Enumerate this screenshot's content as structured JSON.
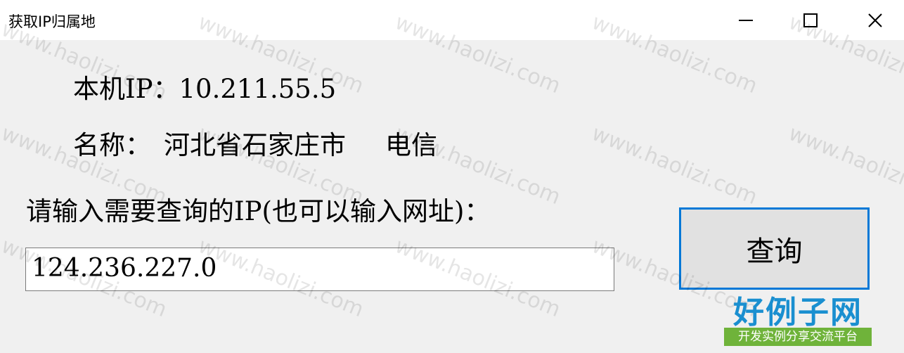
{
  "window": {
    "title": "获取IP归属地",
    "controls": {
      "minimize_icon": "minimize-icon",
      "maximize_icon": "maximize-icon",
      "close_icon": "close-icon"
    }
  },
  "local": {
    "ip_label": "本机IP：",
    "ip_value": "10.211.55.5",
    "name_label": "名称：",
    "location": "河北省石家庄市",
    "isp": "电信"
  },
  "query": {
    "prompt": "请输入需要查询的IP(也可以输入网址)：",
    "input_value": "124.236.227.0",
    "button_label": "查询"
  },
  "watermark": {
    "text": "www.haolizi.com",
    "brand": "好例子网",
    "brand_sub": "开发实例分享交流平台",
    "brand_color": "#1a8fd0",
    "brand_sub_bg": "#6fb33a"
  },
  "colors": {
    "accent": "#0078d7",
    "button_bg": "#e1e1e1",
    "window_bg": "#f0f0f0"
  }
}
